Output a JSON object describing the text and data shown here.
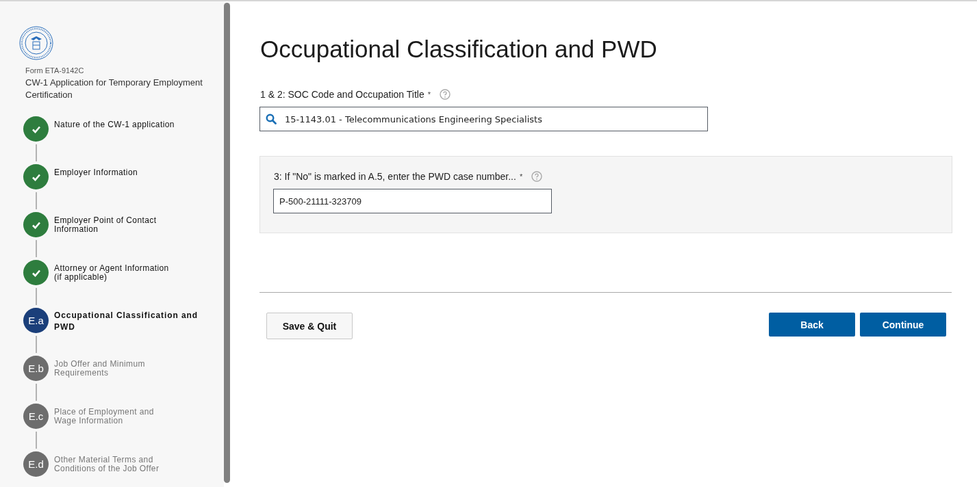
{
  "sidebar": {
    "form_number": "Form ETA-9142C",
    "form_title": "CW-1 Application for Temporary Employment Certification",
    "steps": [
      {
        "kind": "done",
        "label": "Nature of the CW-1 application",
        "selected": false
      },
      {
        "kind": "done",
        "label": "Employer Information",
        "selected": false
      },
      {
        "kind": "done",
        "label": "Employer Point of Contact Information",
        "selected": false
      },
      {
        "kind": "done",
        "label": "Attorney or Agent Information (if applicable)",
        "selected": false
      },
      {
        "kind": "current",
        "badge": "E.a",
        "label": "Occupational Classification and PWD",
        "selected": true
      },
      {
        "kind": "pending",
        "badge": "E.b",
        "label": "Job Offer and Minimum Requirements",
        "selected": false
      },
      {
        "kind": "pending",
        "badge": "E.c",
        "label": "Place of Employment and Wage Information",
        "selected": false
      },
      {
        "kind": "pending",
        "badge": "E.d",
        "label": "Other Material Terms and Conditions of the Job Offer",
        "selected": false
      }
    ]
  },
  "page": {
    "title": "Occupational Classification and PWD",
    "soc_field": {
      "label": "1 & 2: SOC Code and Occupation Title",
      "required_mark": "*",
      "value": "15-1143.01 - Telecommunications Engineering Specialists"
    },
    "pwd_field": {
      "label": "3: If \"No\" is marked in A.5, enter the PWD case number...",
      "required_mark": "*",
      "value": "P-500-21111-323709"
    }
  },
  "buttons": {
    "save_quit": "Save & Quit",
    "back": "Back",
    "continue": "Continue"
  }
}
